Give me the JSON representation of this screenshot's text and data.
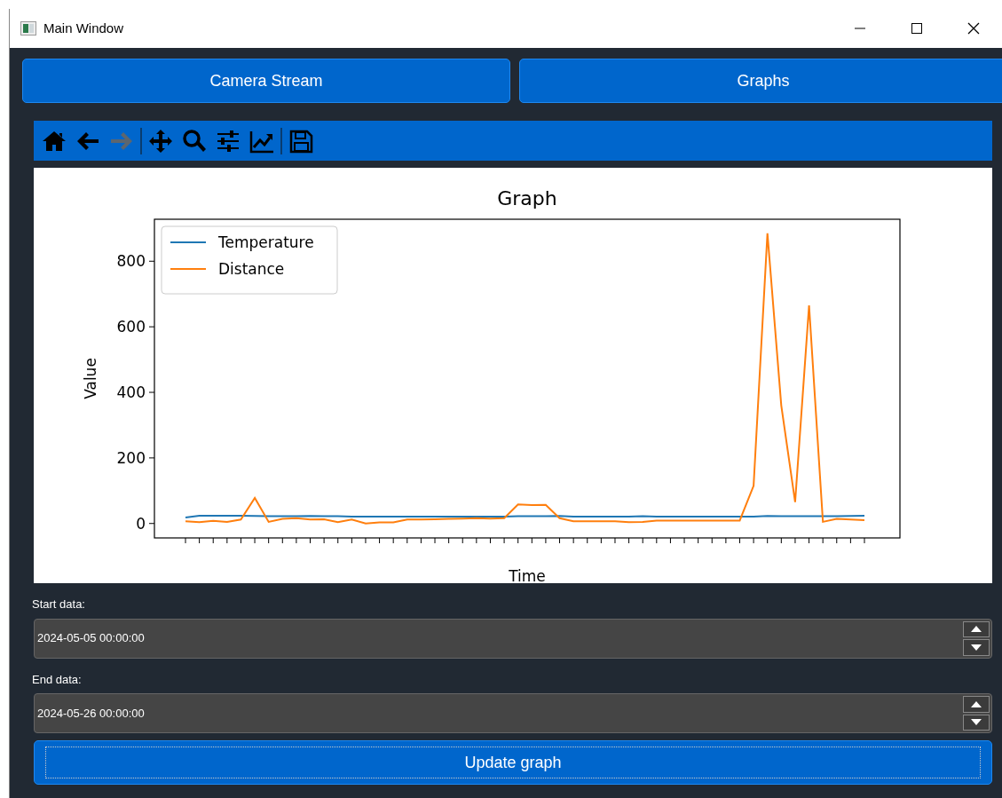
{
  "window": {
    "title": "Main Window"
  },
  "tabs": [
    {
      "label": "Camera Stream"
    },
    {
      "label": "Graphs"
    }
  ],
  "toolbar": {
    "tools": [
      {
        "kind": "home",
        "disabled": false
      },
      {
        "kind": "back",
        "disabled": false
      },
      {
        "kind": "forward",
        "disabled": true
      },
      {
        "kind": "separator",
        "disabled": false
      },
      {
        "kind": "pan",
        "disabled": false
      },
      {
        "kind": "zoom",
        "disabled": false
      },
      {
        "kind": "configure",
        "disabled": false
      },
      {
        "kind": "edit",
        "disabled": false
      },
      {
        "kind": "separator",
        "disabled": false
      },
      {
        "kind": "save",
        "disabled": false
      }
    ]
  },
  "graph": {
    "chart_data": {
      "type": "line",
      "title": "Graph",
      "xlabel": "Time",
      "ylabel": "Value",
      "legend": "upper left",
      "ylim": [
        -44,
        928
      ],
      "yticks": [
        0,
        200,
        400,
        600,
        800
      ],
      "series": [
        {
          "name": "Temperature",
          "color": "#1f77b4",
          "values": [
            18,
            24,
            24,
            24,
            24,
            23,
            22,
            22,
            22,
            23,
            22,
            22,
            21,
            21,
            21,
            21,
            21,
            21,
            21,
            21,
            21,
            21,
            21,
            21,
            22,
            22,
            22,
            23,
            21,
            21,
            21,
            21,
            21,
            22,
            21,
            21,
            21,
            21,
            21,
            21,
            21,
            21,
            23,
            22,
            22,
            22,
            22,
            22,
            23,
            24
          ]
        },
        {
          "name": "Distance",
          "color": "#ff7f0e",
          "values": [
            7,
            4,
            8,
            5,
            12,
            78,
            5,
            14,
            16,
            12,
            13,
            4,
            12,
            0,
            3,
            3,
            12,
            12,
            13,
            14,
            15,
            16,
            15,
            16,
            58,
            56,
            57,
            16,
            7,
            7,
            7,
            7,
            4,
            5,
            9,
            9,
            9,
            9,
            9,
            9,
            9,
            115,
            885,
            360,
            65,
            665,
            5,
            14,
            12,
            10
          ]
        }
      ]
    }
  },
  "start_field": {
    "label": "Start data:",
    "value": "2024-05-05 00:00:00"
  },
  "end_field": {
    "label": "End data:",
    "value": "2024-05-26 00:00:00"
  },
  "update_button": {
    "label": "Update graph"
  }
}
